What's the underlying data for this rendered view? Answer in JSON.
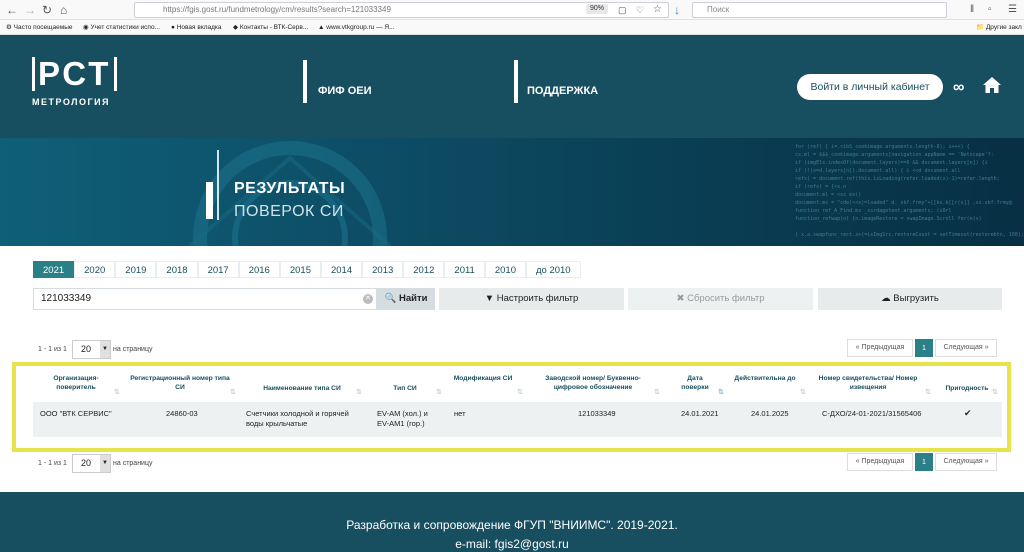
{
  "browser": {
    "url": "https://fgis.gost.ru/fundmetrology/cm/results?search=121033349",
    "zoom": "90%",
    "search_placeholder": "Поиск",
    "bookmarks": [
      "Часто посещаемые",
      "Учет статистики испо...",
      "Новая вкладка",
      "Контакты - ВТК-Серв...",
      "www.vtkgroup.ru — Я...",
      "Другие закл"
    ]
  },
  "header": {
    "logo_main": "РСТ",
    "logo_sub": "МЕТРОЛОГИЯ",
    "nav": [
      "ФИФ ОЕИ",
      "ПОДДЕРЖКА"
    ],
    "login_label": "Войти в личный кабинет"
  },
  "banner": {
    "title_line1": "РЕЗУЛЬТАТЫ",
    "title_line2": "ПОВЕРОК СИ"
  },
  "years": {
    "items": [
      "2021",
      "2020",
      "2019",
      "2018",
      "2017",
      "2016",
      "2015",
      "2014",
      "2013",
      "2012",
      "2011",
      "2010",
      "до 2010"
    ],
    "active": "2021"
  },
  "search": {
    "value": "121033349",
    "find_label": "Найти",
    "filter_label": "Настроить фильтр",
    "reset_label": "Сбросить фильтр",
    "export_label": "Выгрузить"
  },
  "pagination": {
    "info": "1 - 1 из 1",
    "per_page": "20",
    "per_page_label": "на страницу",
    "prev_label": "Предыдущая",
    "next_label": "Следующая",
    "current_page": "1"
  },
  "table": {
    "columns": [
      "Организация-поверитель",
      "Регистрационный номер типа СИ",
      "Наименование типа СИ",
      "Тип СИ",
      "Модификация СИ",
      "Заводской номер/ Буквенно-цифровое обозначение",
      "Дата поверки",
      "Действительна до",
      "Номер свидетельства/ Номер извещения",
      "Пригодность"
    ],
    "rows": [
      {
        "org": "ООО \"ВТК СЕРВИС\"",
        "reg_number": "24860-03",
        "name": "Счетчики холодной и горячей воды крыльчатые",
        "type": "EV-AM (хол.) и EV-AM1 (гор.)",
        "modification": "нет",
        "serial": "121033349",
        "date": "24.01.2021",
        "valid_until": "24.01.2025",
        "certificate": "С-ДХО/24-01-2021/31565406",
        "suitable": "✔"
      }
    ]
  },
  "footer": {
    "line1": "Разработка и сопровождение ФГУП \"ВНИИМС\". 2019-2021.",
    "line2": "e-mail: fgis2@gost.ru"
  }
}
